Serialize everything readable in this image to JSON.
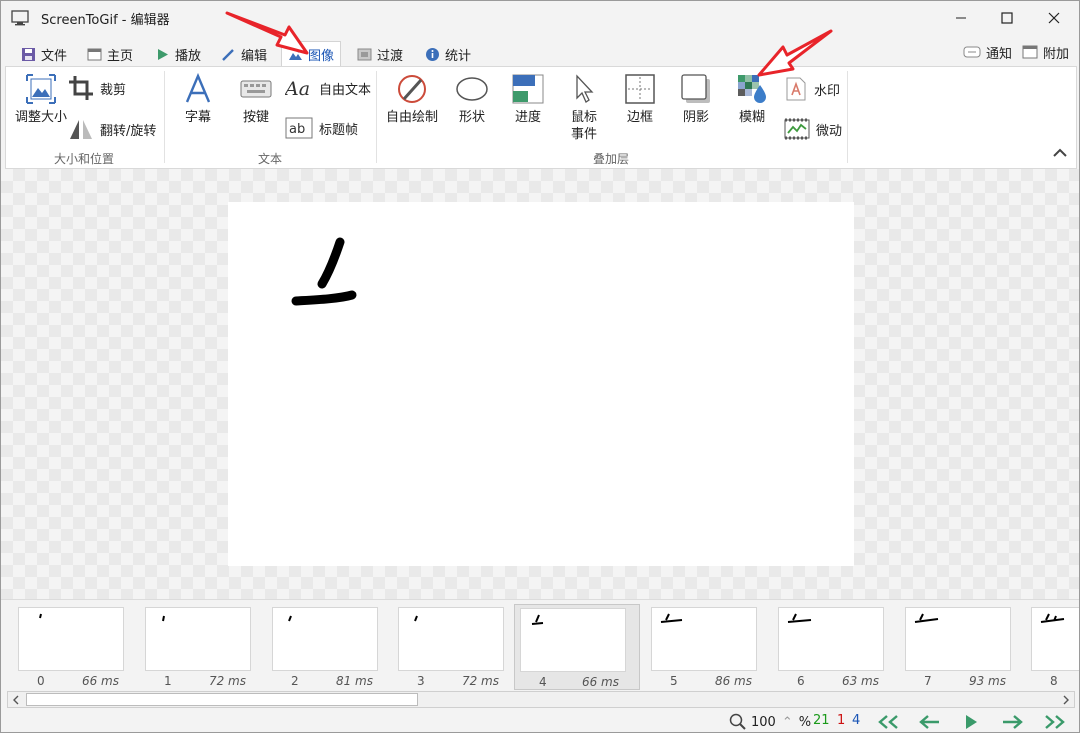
{
  "window": {
    "title": "ScreenToGif - 编辑器"
  },
  "tabs": [
    {
      "label": "文件",
      "icon": "save-icon"
    },
    {
      "label": "主页",
      "icon": "home-icon"
    },
    {
      "label": "播放",
      "icon": "play-icon"
    },
    {
      "label": "编辑",
      "icon": "pencil-icon"
    },
    {
      "label": "图像",
      "icon": "image-icon",
      "active": true
    },
    {
      "label": "过渡",
      "icon": "transition-icon"
    },
    {
      "label": "统计",
      "icon": "info-icon"
    }
  ],
  "right_links": {
    "notify": "通知",
    "extras": "附加"
  },
  "ribbon": {
    "size_position": {
      "resize": "调整大小",
      "crop": "裁剪",
      "flip_rotate": "翻转/旋转",
      "group_label": "大小和位置"
    },
    "text": {
      "caption": "字幕",
      "keystrokes": "按键",
      "free_text": "自由文本",
      "title_frame": "标题帧",
      "group_label": "文本"
    },
    "overlay": {
      "free_drawing": "自由绘制",
      "shapes": "形状",
      "progress": "进度",
      "mouse_events_line1": "鼠标",
      "mouse_events_line2": "事件",
      "border": "边框",
      "shadow": "阴影",
      "blur": "模糊",
      "watermark": "水印",
      "cinemagraph": "微动",
      "group_label": "叠加层"
    }
  },
  "timeline": {
    "frames": [
      {
        "index": "0",
        "delay": "66 ms"
      },
      {
        "index": "1",
        "delay": "72 ms"
      },
      {
        "index": "2",
        "delay": "81 ms"
      },
      {
        "index": "3",
        "delay": "72 ms"
      },
      {
        "index": "4",
        "delay": "66 ms",
        "selected": true
      },
      {
        "index": "5",
        "delay": "86 ms"
      },
      {
        "index": "6",
        "delay": "63 ms"
      },
      {
        "index": "7",
        "delay": "93 ms"
      },
      {
        "index": "8",
        "delay": ""
      }
    ]
  },
  "status": {
    "zoom": "100",
    "zoom_unit": "%",
    "frame_count": "21",
    "selected_count": "1",
    "current_frame": "4",
    "colors": {
      "frame_count": "#1a9a1a",
      "selected_count": "#cc1111",
      "current_frame": "#1a55b5",
      "nav": "#3a9a6a"
    }
  },
  "annotation_color": "#e8242a"
}
